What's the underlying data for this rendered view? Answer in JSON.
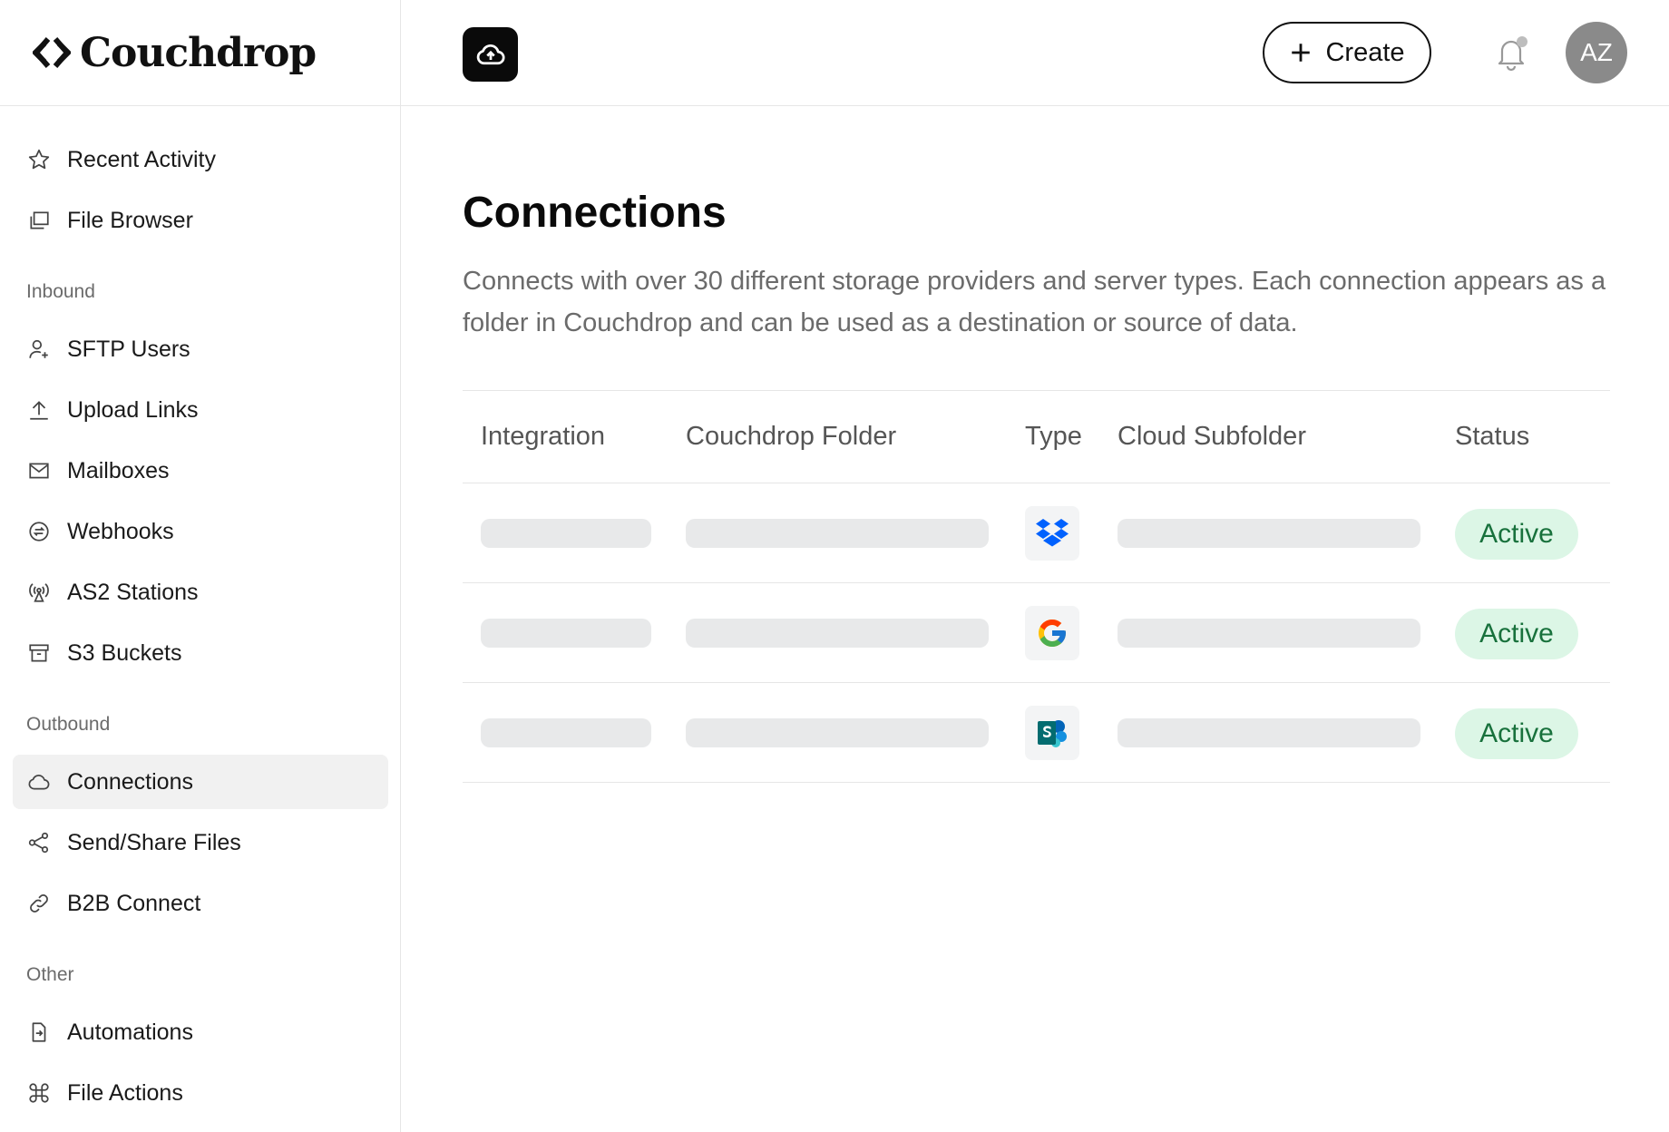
{
  "brand": {
    "name": "Couchdrop"
  },
  "header": {
    "create_label": "Create",
    "avatar_initials": "AZ"
  },
  "sidebar": {
    "top_items": [
      {
        "label": "Recent Activity",
        "icon": "star-icon"
      },
      {
        "label": "File Browser",
        "icon": "files-icon"
      }
    ],
    "sections": [
      {
        "title": "Inbound",
        "items": [
          {
            "label": "SFTP Users",
            "icon": "user-plus-icon"
          },
          {
            "label": "Upload Links",
            "icon": "upload-icon"
          },
          {
            "label": "Mailboxes",
            "icon": "mail-icon"
          },
          {
            "label": "Webhooks",
            "icon": "webhook-icon"
          },
          {
            "label": "AS2 Stations",
            "icon": "antenna-icon"
          },
          {
            "label": "S3 Buckets",
            "icon": "archive-icon"
          }
        ]
      },
      {
        "title": "Outbound",
        "items": [
          {
            "label": "Connections",
            "icon": "cloud-icon",
            "active": true
          },
          {
            "label": "Send/Share Files",
            "icon": "share-icon"
          },
          {
            "label": "B2B Connect",
            "icon": "link-icon"
          }
        ]
      },
      {
        "title": "Other",
        "items": [
          {
            "label": "Automations",
            "icon": "automation-icon"
          },
          {
            "label": "File Actions",
            "icon": "command-icon"
          }
        ]
      }
    ]
  },
  "main": {
    "title": "Connections",
    "description": "Connects with over 30 different storage providers and server types. Each connection appears as a folder in Couchdrop and can be used as a destination or source of data.",
    "table": {
      "columns": [
        "Integration",
        "Couchdrop Folder",
        "Type",
        "Cloud Subfolder",
        "Status"
      ],
      "rows": [
        {
          "type_icon": "dropbox-icon",
          "status": "Active"
        },
        {
          "type_icon": "google-icon",
          "status": "Active"
        },
        {
          "type_icon": "sharepoint-icon",
          "status": "Active"
        }
      ]
    }
  },
  "colors": {
    "accent": "#111111",
    "status_active_bg": "#dcf6e6",
    "status_active_text": "#18713c",
    "skeleton": "#e8e9ea"
  }
}
